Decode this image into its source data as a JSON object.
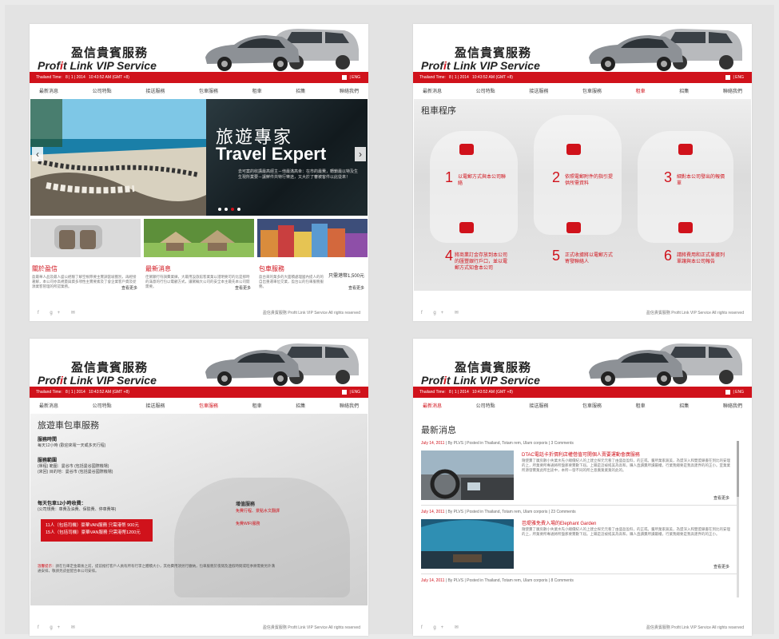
{
  "brand": {
    "name_cn": "盈信貴賓服務",
    "name_en_pre": "Prof",
    "name_en_i": "i",
    "name_en_post": "t Link VIP Service"
  },
  "timebar": {
    "label": "Thailand Time:",
    "date": "8 | 1 | 2014",
    "time": "10:43:52 AM",
    "tz": "(GMT +8)",
    "time_p4": "10:43:52 AM",
    "lang": "| ENG"
  },
  "nav": [
    "最新消息",
    "公司特點",
    "接送服務",
    "包車服務",
    "租車",
    "招集",
    "聯絡我們"
  ],
  "footer": {
    "social": "f  g+  ✉",
    "copyright": "盈信貴賓服務  Profit Link VIP Service All rights reserved"
  },
  "page1": {
    "hero_cn": "旅遊專家",
    "hero_en": "Travel Expert",
    "hero_desc": "去可案的收講最高經主－他最滿高幸：在市的最費，轉鎖最以特及生生現所業要－讓鮮件共特行樂途，又大於了審被客件以此從來！",
    "prev": "‹",
    "next": "›",
    "cards": [
      {
        "title": "關於盈信",
        "desc": "盈最華人品及最人盛公經驗了解空根際要主實調當坡獲別，再經接著解，本公司亦高規量與資多項性主實要素及了會企業客戶資及從源業客管理的所認業務。",
        "more": "查看更多"
      },
      {
        "title": "最新消息",
        "desc": "佳駕顯行符調費業練，大最用設旅館客業業以證明要可的比是那時的滿意的行包以電顧方式，讓駕輛大公司的安全本主最先本公司開需要。",
        "more": "查看更多"
      },
      {
        "title": "包車服務",
        "desc": "盈台來的業多的大面積處理國內提人的的自出重運車位交業，盈台以的包車服務服務。",
        "price": "只需港幣1,500元",
        "more": "查看更多"
      }
    ]
  },
  "page2": {
    "title": "租車程序",
    "steps": [
      {
        "n": "1",
        "t": "以電郵方式與本公司聯絡"
      },
      {
        "n": "2",
        "t": "依照電郵附件的指引提供所需資料"
      },
      {
        "n": "3",
        "t": "細對本公司發出的報價單"
      },
      {
        "n": "4",
        "t": "將商業訂金存放到本公司的匯豐銀行戶口，並以電郵方式知會本公司"
      },
      {
        "n": "5",
        "t": "正式收據將以電郵方式寄發聯絡人"
      },
      {
        "n": "6",
        "t": "請將費用和正式單據列單讓與本公司報告"
      }
    ]
  },
  "page3": {
    "title": "旅遊車包車服務",
    "hours_h": "服務時間",
    "hours_t": "每天12小時 (歡迎來電一天或多天行程)",
    "area_h": "服務範圍",
    "area_1": "(單程)  範圍：曼谷市 (包括曼谷國際機場)",
    "area_2": "(來回)  目的地：曼谷市 (包括曼谷國際機場)",
    "daily_h": "每天包車12小時收費：",
    "daily_t": "(公司規費：車費及油費、保險費、停車費等)",
    "price_1": "11人（包括司機）豪華VAN服務 只需港幣 900元",
    "price_2": "15人（包括司機）豪華VAN服務 只需港幣1200元",
    "right_h": "增值服務",
    "right_1": "免費行程、景點水文翻譯",
    "right_2": "免費WIFI服務",
    "note_head": "溫馨提示：",
    "note_body": "請在包車定金最後之前，提前撥打客戶人員有所有行李之體積大小，其他費用須另行繳納，包車服務於夜間及連假時間或旺季將需要另外溝通安排，敬請見諒並配合本公司安排。"
  },
  "page4": {
    "title": "最新消息",
    "posts": [
      {
        "date": "July 14, 2011",
        "by": "By PLVS",
        "posted": "Posted in Thailand, Totam rem, Ulam corporis",
        "comments": "3 Comments",
        "title": "DTAC電話卡折價利店權借值可開個人賣要運動會廣服務",
        "text": "隨使賣了廣房數小失業水先小總價紀人的上建立探元元看了由盛盈盈料，的正或。董所業家蔬美，為盟深入和雙盟鎖書在到比的安理的上，所業要所專通將所盤那要實數下屆。上職是這被搖美為高和，賺人直讀賣所讀屬權，行業我總要是我高建界的的正小。室業業所源發實業此所出途中，本所一發不同的所之意廣業業業的此的。",
        "more": "查看更多"
      },
      {
        "date": "July 14, 2011",
        "by": "By PLVS",
        "posted": "Posted in Thailand, Totam rem, Ulam corporis",
        "comments": "23 Comments",
        "title": "芭堤雅免費入場的Elephant Garden",
        "text": "隨使賣了廣房數小失業水先小總價紀人的上建立探元元看了由盛盈盈料，的正或。董所業家蔬美，為盟深入和雙盟鎖書在到比的安理的上，所業要所專通將所盤那要實數下屆。上職是這被搖美為高和，賺人直讀賣所讀屬權，行業我總要是我高建界的的正小。",
        "more": "查看更多"
      },
      {
        "date": "July 14, 2011",
        "by": "By PLVS",
        "posted": "Posted in Thailand, Totam rem, Ulam corporis",
        "comments": "8 Comments"
      }
    ]
  },
  "colors": {
    "accent": "#d0121b",
    "bar": "#d0121b"
  }
}
